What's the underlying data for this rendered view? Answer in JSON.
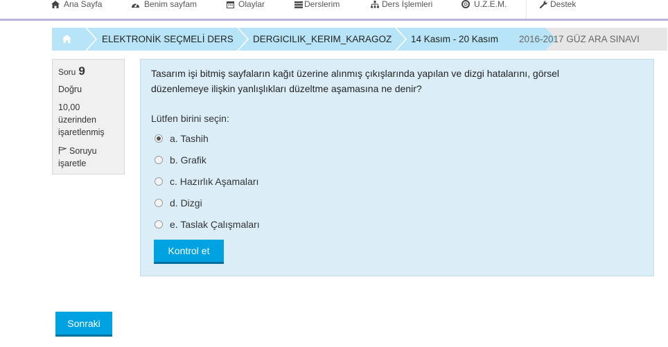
{
  "nav": {
    "items": [
      {
        "label": "Ana Sayfa",
        "icon": "home-icon"
      },
      {
        "label": "Benim sayfam",
        "icon": "dashboard-icon"
      },
      {
        "label": "Olaylar",
        "icon": "calendar-icon"
      },
      {
        "label": "Derslerim",
        "icon": "courses-icon"
      },
      {
        "label": "Ders İşlemleri",
        "icon": "sitemap-icon"
      },
      {
        "label": "U.Z.E.M.",
        "icon": "lifebuoy-icon"
      },
      {
        "label": "Destek",
        "icon": "wrench-icon"
      }
    ]
  },
  "breadcrumb": {
    "home_icon": "home-icon",
    "items": [
      "ELEKTRONİK SEÇMELİ DERS",
      "DERGICILIK_KERIM_KARAGOZ",
      "14 Kasım - 20 Kasım",
      "2016-2017 GÜZ ARA SINAVI"
    ]
  },
  "question_info": {
    "label": "Soru",
    "number": "9",
    "state": "Doğru",
    "grade_line1": "10,00",
    "grade_line2": "üzerinden",
    "grade_line3": "işaretlenmiş",
    "flag_line1": "Soruyu",
    "flag_line2": "işaretle"
  },
  "question": {
    "text_line1": "Tasarım işi bitmiş sayfaların kağıt üzerine alınmış çıkışlarında yapılan ve dizgi hatalarını, görsel",
    "text_line2": "düzenlemeye ilişkin yanlışlıkları düzeltme aşamasına ne denir?",
    "prompt": "Lütfen birini seçin:",
    "options": [
      {
        "label": "a. Tashih",
        "selected": true
      },
      {
        "label": "b. Grafik",
        "selected": false
      },
      {
        "label": "c. Hazırlık Aşamaları",
        "selected": false
      },
      {
        "label": "d. Dizgi",
        "selected": false
      },
      {
        "label": "e. Taslak Çalışmaları",
        "selected": false
      }
    ],
    "check_button": "Kontrol et"
  },
  "footer": {
    "next_button": "Sonraki"
  },
  "colors": {
    "accent": "#00a2e1",
    "breadcrumb_blue": "#b8e4f7",
    "question_bg": "#dbeef8"
  }
}
